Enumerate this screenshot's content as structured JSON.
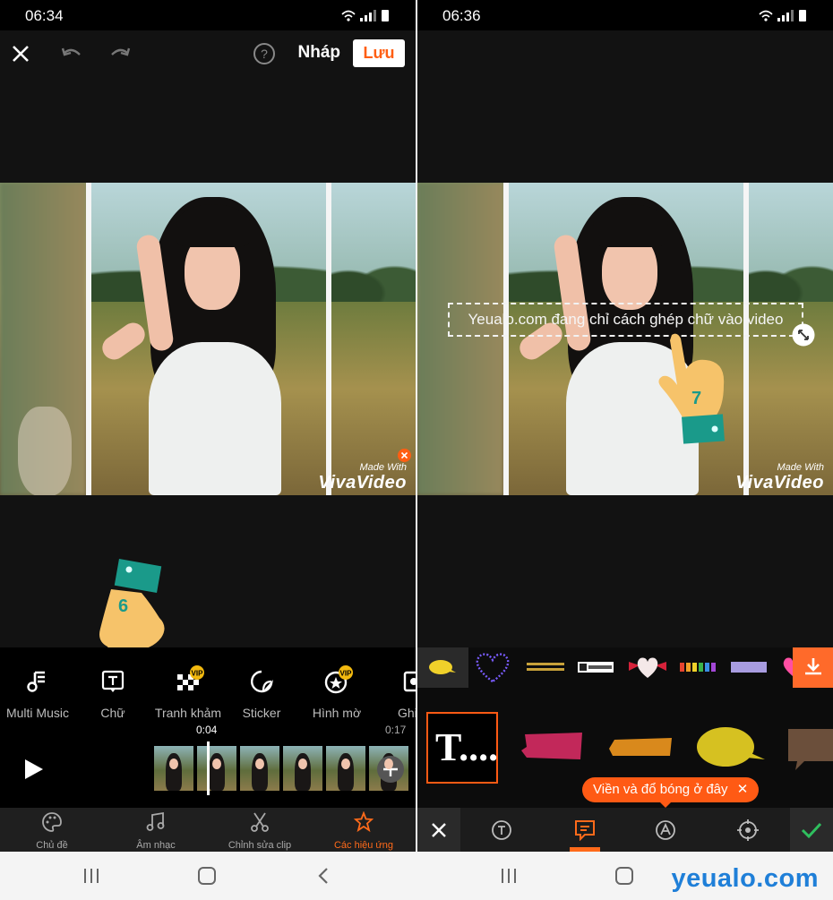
{
  "left": {
    "status_time": "06:34",
    "draft_label": "Nháp",
    "save_label": "Lưu",
    "watermark_small": "Made With",
    "watermark_big": "VivaVideo",
    "hand_step": "6",
    "tools": [
      {
        "label": "Multi Music",
        "icon": "multi-music-icon"
      },
      {
        "label": "Chữ",
        "icon": "text-icon"
      },
      {
        "label": "Tranh khảm",
        "icon": "mosaic-icon",
        "badge": "VIP"
      },
      {
        "label": "Sticker",
        "icon": "sticker-icon"
      },
      {
        "label": "Hình mờ",
        "icon": "watermark-icon",
        "badge": "VIP"
      },
      {
        "label": "Ghi",
        "icon": "record-icon"
      }
    ],
    "timeline": {
      "current": "0:04",
      "total": "0:17"
    },
    "bottom_nav": [
      {
        "label": "Chủ đề",
        "icon": "palette-icon",
        "active": false
      },
      {
        "label": "Âm nhạc",
        "icon": "music-icon",
        "active": false
      },
      {
        "label": "Chỉnh sửa clip",
        "icon": "scissors-icon",
        "active": false
      },
      {
        "label": "Các hiệu ứng",
        "icon": "effects-icon",
        "active": true
      }
    ]
  },
  "right": {
    "status_time": "06:36",
    "overlay_text": "Yeualo.com đang chỉ cách ghép chữ vào video",
    "watermark_small": "Made With",
    "watermark_big": "VivaVideo",
    "hand_step": "7",
    "sticker_thumbs": [
      "speech-bubble",
      "heart-dots",
      "gold-lines",
      "abc-box",
      "heart-bow",
      "abc-colors",
      "purple-tape",
      "pink-heart"
    ],
    "text_style_label": "T....",
    "tooltip": "Viền và đổ bóng ở đây",
    "tabs": [
      "close",
      "font",
      "style",
      "color",
      "position",
      "confirm"
    ]
  },
  "brand": "yeualo.com",
  "colors": {
    "accent": "#ff5e12",
    "active_tab": "#ff6a1a",
    "confirm": "#2fbf5e",
    "brand": "#1f7fd8"
  }
}
